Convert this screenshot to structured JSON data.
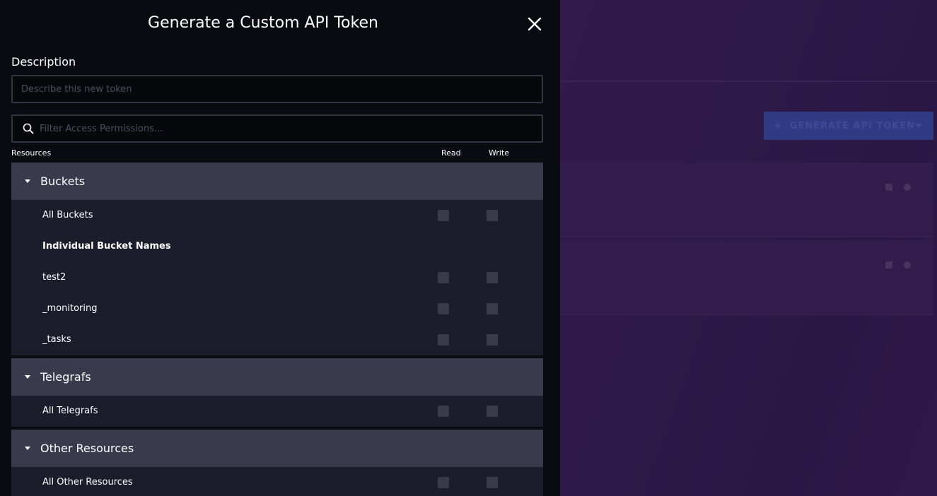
{
  "modal": {
    "title": "Generate a Custom API Token",
    "description_label": "Description",
    "description_placeholder": "Describe this new token",
    "filter_placeholder": "Filter Access Permissions...",
    "columns": {
      "resources": "Resources",
      "read": "Read",
      "write": "Write"
    }
  },
  "sections": {
    "buckets": {
      "title": "Buckets",
      "all_label": "All Buckets",
      "individual_label": "Individual Bucket Names",
      "items": [
        "test2",
        "_monitoring",
        "_tasks"
      ]
    },
    "telegrafs": {
      "title": "Telegrafs",
      "all_label": "All Telegrafs"
    },
    "other": {
      "title": "Other Resources",
      "all_label": "All Other Resources"
    }
  },
  "background": {
    "generate_button_label": "GENERATE API TOKEN",
    "accent_color": "#2f3b82"
  },
  "colors": {
    "overlay_bg": "#0a0b10",
    "section_header_bg": "#393a4c",
    "section_body_bg": "#1c1d2b",
    "checkbox": "#3a3b48"
  }
}
